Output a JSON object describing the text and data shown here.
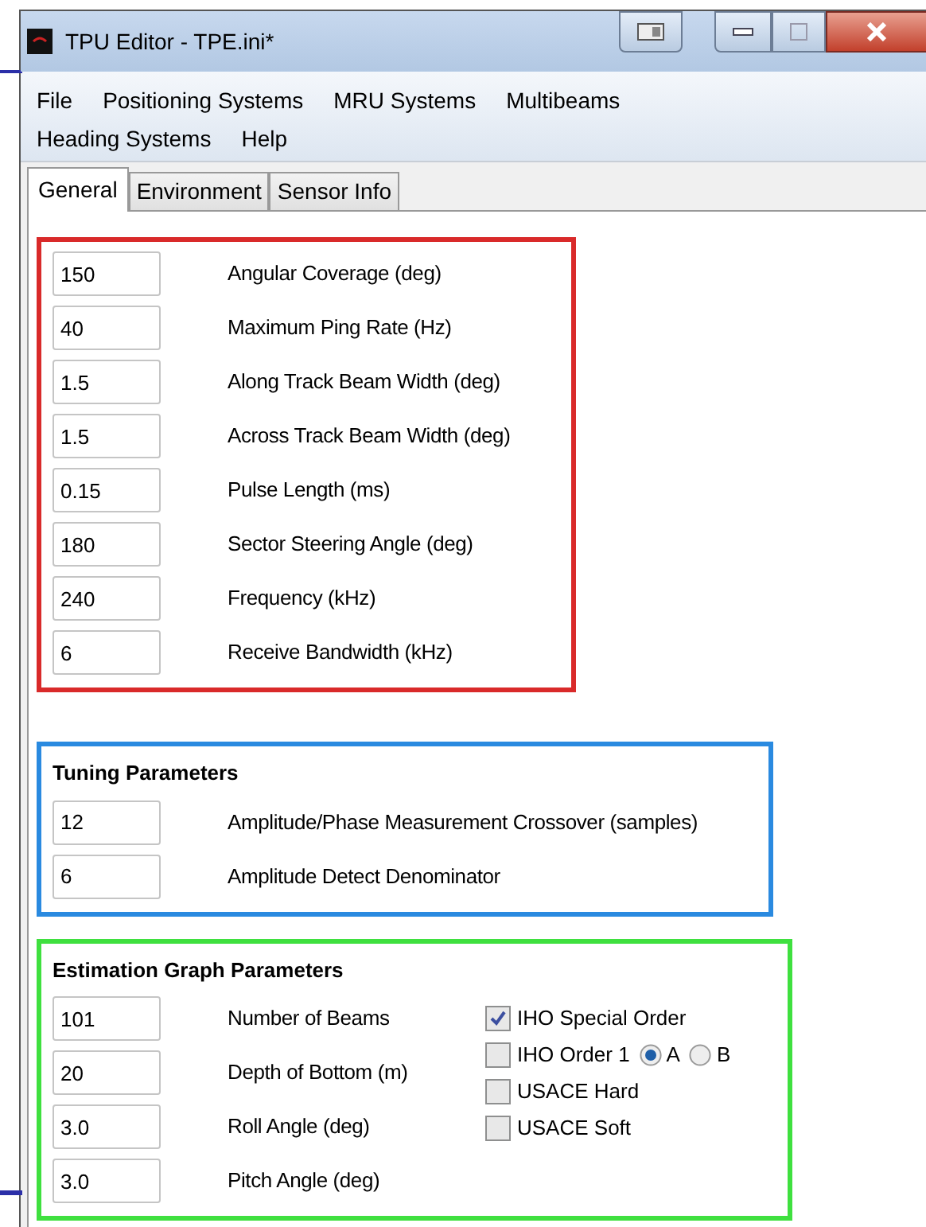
{
  "window": {
    "title": "TPU Editor - TPE.ini*"
  },
  "menu_rows": [
    [
      {
        "label": "File"
      },
      {
        "label": "Positioning Systems"
      },
      {
        "label": "MRU Systems"
      },
      {
        "label": "Multibeams"
      }
    ],
    [
      {
        "label": "Heading Systems"
      },
      {
        "label": "Help"
      }
    ]
  ],
  "tabs": [
    {
      "label": "General",
      "selected": true
    },
    {
      "label": "Environment",
      "selected": false
    },
    {
      "label": "Sensor Info",
      "selected": false
    }
  ],
  "groups": [
    {
      "color": "#d92a2a",
      "fields": [
        {
          "value": "150",
          "label": "Angular Coverage (deg)"
        },
        {
          "value": "40",
          "label": "Maximum Ping Rate (Hz)"
        },
        {
          "value": "1.5",
          "label": "Along Track Beam Width (deg)"
        },
        {
          "value": "1.5",
          "label": "Across Track Beam Width (deg)"
        },
        {
          "value": "0.15",
          "label": "Pulse Length (ms)"
        },
        {
          "value": "180",
          "label": "Sector Steering Angle (deg)"
        },
        {
          "value": "240",
          "label": "Frequency (kHz)"
        },
        {
          "value": "6",
          "label": "Receive Bandwidth (kHz)"
        }
      ]
    },
    {
      "title": "Tuning Parameters",
      "color": "#2a8ae0",
      "fields": [
        {
          "value": "12",
          "label": "Amplitude/Phase Measurement Crossover (samples)"
        },
        {
          "value": "6",
          "label": "Amplitude Detect Denominator"
        }
      ]
    },
    {
      "title": "Estimation Graph Parameters",
      "color": "#3fe03f",
      "fields": [
        {
          "value": "101",
          "label": "Number of Beams"
        },
        {
          "value": "20",
          "label": "Depth of Bottom (m)"
        },
        {
          "value": "3.0",
          "label": "Roll Angle (deg)"
        },
        {
          "value": "3.0",
          "label": "Pitch Angle (deg)"
        }
      ],
      "options": [
        {
          "label": "IHO Special Order",
          "checked": true
        },
        {
          "label": "IHO Order 1",
          "checked": false,
          "radios": [
            {
              "label": "A",
              "selected": true
            },
            {
              "label": "B",
              "selected": false
            }
          ]
        },
        {
          "label": "USACE Hard",
          "checked": false
        },
        {
          "label": "USACE Soft",
          "checked": false
        }
      ]
    }
  ]
}
